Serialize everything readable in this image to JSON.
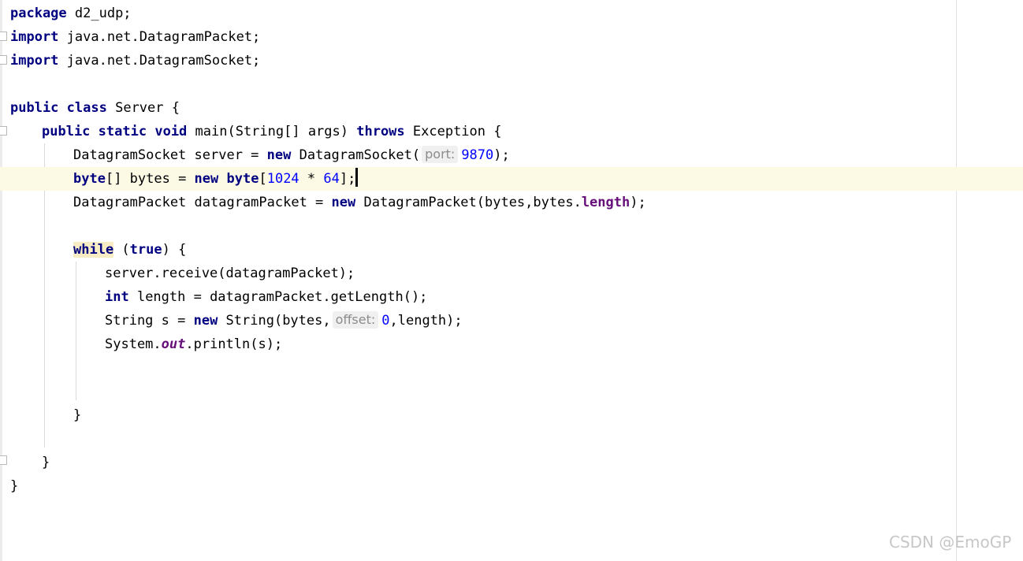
{
  "editor": {
    "l1": {
      "kw": "package",
      "rest": " d2_udp;"
    },
    "l2": {
      "kw": "import",
      "rest": " java.net.DatagramPacket;"
    },
    "l3": {
      "kw": "import",
      "rest": " java.net.DatagramSocket;"
    },
    "l5": {
      "kw1": "public",
      "kw2": "class",
      "rest": " Server {"
    },
    "l6": {
      "kw1": "public",
      "kw2": "static",
      "kw3": "void",
      "mid": " main(String[] args) ",
      "kw4": "throws",
      "rest": " Exception {"
    },
    "l7": {
      "pre": "DatagramSocket server = ",
      "kw": "new",
      "mid": " DatagramSocket(",
      "hint": "port:",
      "num": "9870",
      "post": ");"
    },
    "l8": {
      "kw1": "byte",
      "mid1": "[] bytes = ",
      "kw2": "new",
      "kw3": "byte",
      "mid2": "[",
      "num1": "1024",
      "op": " * ",
      "num2": "64",
      "post": "];"
    },
    "l9": {
      "pre": "DatagramPacket datagramPacket = ",
      "kw": "new",
      "mid": " DatagramPacket(bytes,bytes.",
      "field": "length",
      "post": ");"
    },
    "l11": {
      "kw1": "while",
      "mid": " (",
      "kw2": "true",
      "post": ") {"
    },
    "l12": {
      "text": "server.receive(datagramPacket);"
    },
    "l13": {
      "kw": "int",
      "rest": " length = datagramPacket.getLength();"
    },
    "l14": {
      "pre": "String s = ",
      "kw": "new",
      "mid": " String(bytes,",
      "hint": "offset:",
      "num": "0",
      "post": ",length);"
    },
    "l15": {
      "pre": "System.",
      "field": "out",
      "post": ".println(s);"
    },
    "l18": {
      "text": "}"
    },
    "l20": {
      "text": "}"
    },
    "l21": {
      "text": "}"
    }
  },
  "watermark": "CSDN @EmoGP"
}
